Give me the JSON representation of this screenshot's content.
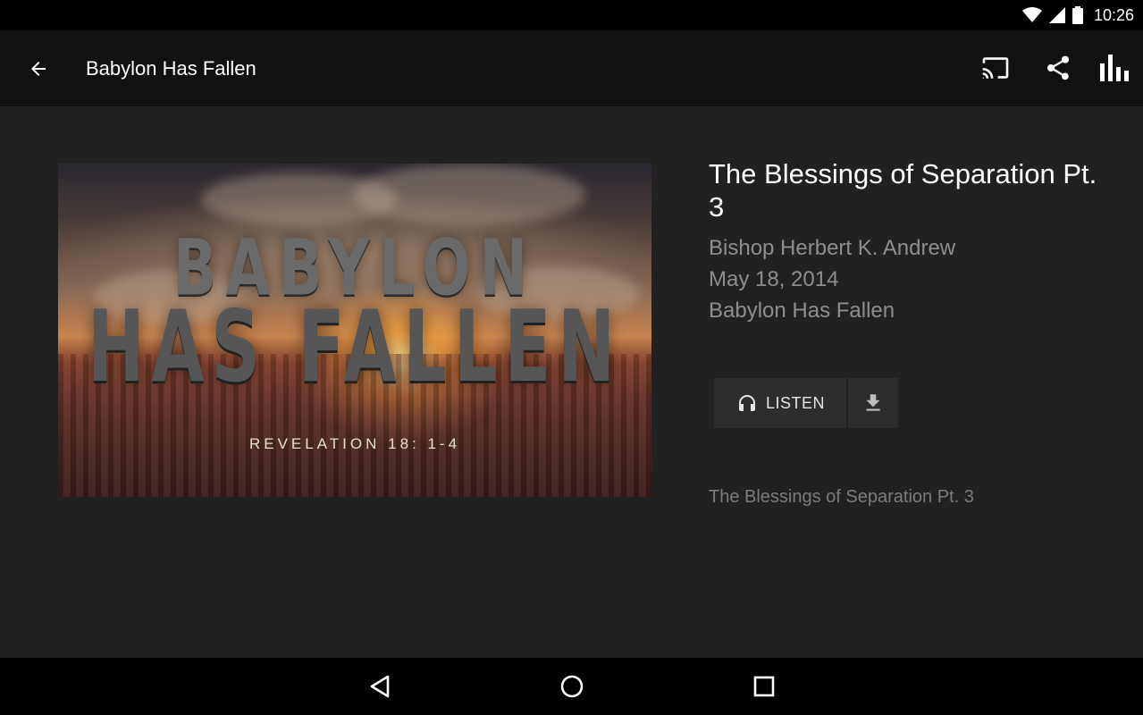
{
  "status_bar": {
    "time": "10:26",
    "icons": [
      "wifi-icon",
      "cell-signal-icon",
      "battery-icon"
    ]
  },
  "app_bar": {
    "title": "Babylon Has Fallen",
    "actions": [
      "cast-icon",
      "share-icon",
      "equalizer-icon"
    ]
  },
  "artwork": {
    "line1": "BABYLON",
    "line2": "HAS FALLEN",
    "verse": "REVELATION 18: 1-4"
  },
  "sermon": {
    "title": "The Blessings of Separation Pt. 3",
    "speaker": "Bishop Herbert K. Andrew",
    "date": "May 18, 2014",
    "series": "Babylon Has Fallen",
    "description": "The Blessings of Separation Pt. 3"
  },
  "actions": {
    "listen_label": "LISTEN"
  },
  "colors": {
    "background": "#212121",
    "app_bar": "#111111",
    "button": "#2d2d2d",
    "secondary_text": "#8e8e8e"
  }
}
